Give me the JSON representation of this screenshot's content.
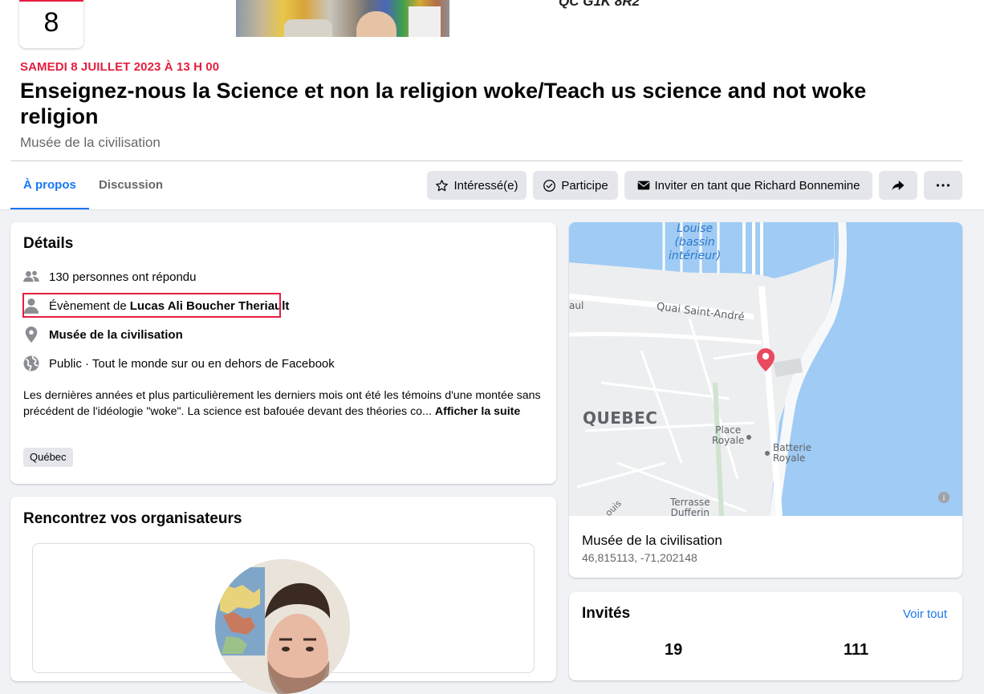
{
  "header": {
    "date_day": "8",
    "address_partial": "QC G1K 8R2",
    "event_date": "SAMEDI 8 JUILLET 2023 À 13 H 00",
    "event_title": "Enseignez-nous la Science et non la religion woke/Teach us science and not woke religion",
    "venue": "Musée de la civilisation"
  },
  "tabs": [
    {
      "label": "À propos",
      "active": true
    },
    {
      "label": "Discussion",
      "active": false
    }
  ],
  "actions": {
    "interested": "Intéressé(e)",
    "going": "Participe",
    "invite": "Inviter en tant que Richard Bonnemine",
    "share_icon": "share-icon",
    "more": "···"
  },
  "details": {
    "title": "Détails",
    "responded": "130 personnes ont répondu",
    "organizer_prefix": "Évènement de ",
    "organizer_name": "Lucas Ali Boucher Theriault",
    "location": "Musée de la civilisation",
    "privacy": "Public · Tout le monde sur ou en dehors de Facebook",
    "description": "Les dernières années et plus particulièrement les derniers mois ont été les témoins d'une montée sans précédent de l'idéologie \"woke\". La science est bafouée devant des théories co...",
    "see_more": "Afficher la suite",
    "tag": "Québec"
  },
  "organizers": {
    "title": "Rencontrez vos organisateurs"
  },
  "map": {
    "labels": {
      "basin_1": "Louise",
      "basin_2": "(bassin",
      "basin_3": "intérieur)",
      "quai": "Quai Saint-André",
      "city": "QUEBEC",
      "place_1": "Place",
      "place_2": "Royale",
      "batterie_1": "Batterie",
      "batterie_2": "Royale",
      "terrasse_1": "Terrasse",
      "terrasse_2": "Dufferin",
      "edge_left": "aul",
      "edge_bottom": "ouis"
    },
    "location_name": "Musée de la civilisation",
    "coordinates": "46,815113, -71,202148",
    "accent": "#e94a5f"
  },
  "guests": {
    "title": "Invités",
    "see_all": "Voir tout",
    "count_going": "19",
    "count_interested": "111"
  },
  "colors": {
    "accent_blue": "#1877f2",
    "accent_red": "#e41e3f"
  }
}
